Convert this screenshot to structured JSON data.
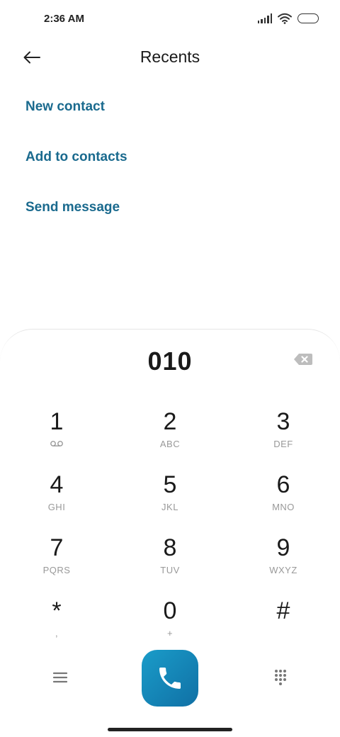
{
  "status_bar": {
    "time": "2:36 AM",
    "icons": [
      "signal-icon",
      "wifi-icon",
      "battery-icon"
    ]
  },
  "header": {
    "back_icon": "back-arrow-icon",
    "title": "Recents"
  },
  "actions": [
    {
      "label": "New contact"
    },
    {
      "label": "Add to contacts"
    },
    {
      "label": "Send message"
    }
  ],
  "dialer": {
    "number": "010",
    "backspace_icon": "backspace-icon",
    "keys": [
      {
        "digit": "1",
        "sub": ""
      },
      {
        "digit": "2",
        "sub": "ABC"
      },
      {
        "digit": "3",
        "sub": "DEF"
      },
      {
        "digit": "4",
        "sub": "GHI"
      },
      {
        "digit": "5",
        "sub": "JKL"
      },
      {
        "digit": "6",
        "sub": "MNO"
      },
      {
        "digit": "7",
        "sub": "PQRS"
      },
      {
        "digit": "8",
        "sub": "TUV"
      },
      {
        "digit": "9",
        "sub": "WXYZ"
      },
      {
        "digit": "*",
        "sub": ","
      },
      {
        "digit": "0",
        "sub": "+"
      },
      {
        "digit": "#",
        "sub": ""
      }
    ],
    "voicemail_icon": "voicemail-icon"
  },
  "bottom": {
    "menu_icon": "menu-icon",
    "call_icon": "phone-icon",
    "keypad_icon": "dialpad-icon"
  },
  "colors": {
    "accent": "#1a6a8e",
    "call_button": "#1a8bbd"
  }
}
